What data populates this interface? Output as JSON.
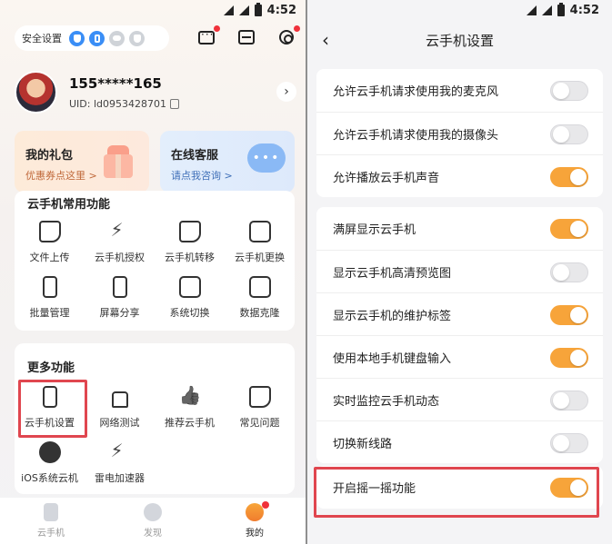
{
  "left": {
    "status": {
      "time": "4:52"
    },
    "security": {
      "label": "安全设置"
    },
    "profile": {
      "phone": "155*****165",
      "uid": "UID: ld0953428701"
    },
    "cards": {
      "gift": {
        "title": "我的礼包",
        "subtitle": "优惠券点这里 >"
      },
      "service": {
        "title": "在线客服",
        "subtitle": "请点我咨询 >"
      }
    },
    "common": {
      "title": "云手机常用功能",
      "items": [
        {
          "label": "文件上传"
        },
        {
          "label": "云手机授权"
        },
        {
          "label": "云手机转移"
        },
        {
          "label": "云手机更换"
        },
        {
          "label": "批量管理"
        },
        {
          "label": "屏幕分享"
        },
        {
          "label": "系统切换"
        },
        {
          "label": "数据克隆"
        }
      ]
    },
    "more": {
      "title": "更多功能",
      "items": [
        {
          "label": "云手机设置"
        },
        {
          "label": "网络测试"
        },
        {
          "label": "推荐云手机"
        },
        {
          "label": "常见问题"
        },
        {
          "label": "iOS系统云机"
        },
        {
          "label": "雷电加速器"
        }
      ]
    },
    "tabs": [
      {
        "label": "云手机"
      },
      {
        "label": "发现"
      },
      {
        "label": "我的"
      }
    ],
    "colors": {
      "accent": "#f7a43a",
      "highlight": "#e0464f"
    }
  },
  "right": {
    "status": {
      "time": "4:52"
    },
    "title": "云手机设置",
    "group1": [
      {
        "label": "允许云手机请求使用我的麦克风",
        "on": false
      },
      {
        "label": "允许云手机请求使用我的摄像头",
        "on": false
      },
      {
        "label": "允许播放云手机声音",
        "on": true
      }
    ],
    "group2": [
      {
        "label": "满屏显示云手机",
        "on": true
      },
      {
        "label": "显示云手机高清预览图",
        "on": false
      },
      {
        "label": "显示云手机的维护标签",
        "on": true
      },
      {
        "label": "使用本地手机键盘输入",
        "on": true
      },
      {
        "label": "实时监控云手机动态",
        "on": false
      },
      {
        "label": "切换新线路",
        "on": false
      }
    ],
    "group3": [
      {
        "label": "开启摇一摇功能",
        "on": true
      }
    ]
  }
}
